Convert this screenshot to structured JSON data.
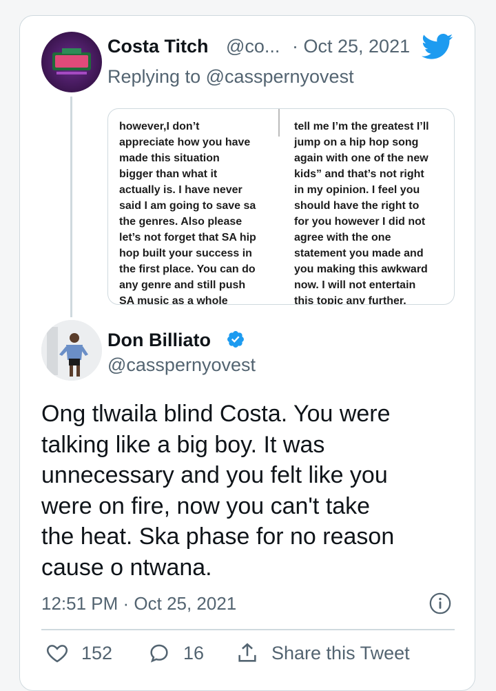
{
  "reply_tweet": {
    "author_name": "Costa Titch",
    "author_handle": "@co...",
    "separator_date": "· Oct 25, 2021",
    "replying_to": "Replying to @casspernyovest",
    "screenshot_left_lines": "however,I don’t\nappreciate how you have\nmade this situation\nbigger than what it\nactually is. I have never\nsaid I am going to save sa\nthe genres. Also please\nlet’s not forget that SA hip\nhop built your success in\nthe first place. You can do\nany genre and still push\nSA music as a whole",
    "screenshot_right_lines": "tell me I’m the greatest I’ll\njump on a hip hop song\nagain with one of the new\nkids” and that’s not right\nin my opinion. I feel you\nshould have the right to\nfor you however I did not\nagree with the one\nstatement you made and\nyou making this awkward\nnow. I will not entertain\nthis topic any further."
  },
  "main_tweet": {
    "author_name": "Don Billiato",
    "author_handle": "@casspernyovest",
    "text": "Ong tlwaila blind Costa. You were\ntalking like a big boy. It was\nunnecessary and you felt like you\nwere on fire,  now you can't take\nthe heat. Ska phase for no reason\ncause o ntwana.",
    "timestamp": "12:51 PM · Oct 25, 2021"
  },
  "actions": {
    "likes": "152",
    "replies": "16",
    "share_label": "Share this Tweet"
  },
  "colors": {
    "brand_blue": "#1d9bf0",
    "text_primary": "#0f1419",
    "text_secondary": "#536471",
    "border": "#cfd9de"
  },
  "icons": [
    "twitter-bird-icon",
    "verified-badge-icon",
    "info-icon",
    "heart-icon",
    "reply-icon",
    "share-icon"
  ]
}
